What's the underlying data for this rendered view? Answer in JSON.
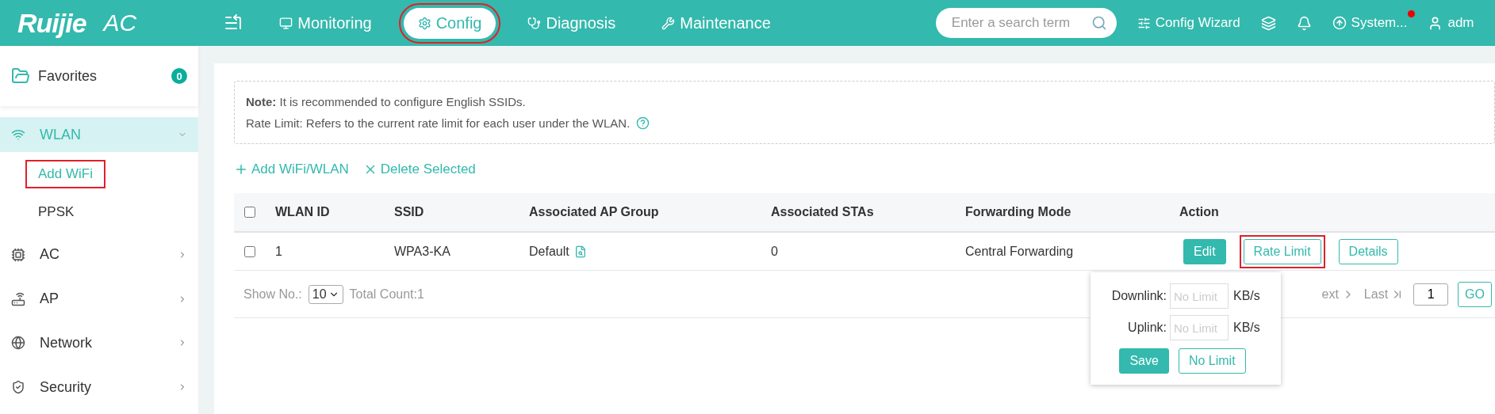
{
  "header": {
    "logo": "Ruijie",
    "product": "AC",
    "nav": [
      {
        "label": "Monitoring",
        "selected": false,
        "highlighted": false
      },
      {
        "label": "Config",
        "selected": true,
        "highlighted": true
      },
      {
        "label": "Diagnosis",
        "selected": false,
        "highlighted": false
      },
      {
        "label": "Maintenance",
        "selected": false,
        "highlighted": false
      }
    ],
    "search": {
      "placeholder": "Enter a search term"
    },
    "config_wizard": "Config Wizard",
    "system": {
      "label": "System...",
      "alert": true
    },
    "user": "adm"
  },
  "sidebar": {
    "favorites": {
      "label": "Favorites",
      "count": "0"
    },
    "items": [
      {
        "label": "WLAN",
        "selected": true,
        "expanded": true,
        "children": [
          {
            "label": "Add WiFi",
            "selected": true,
            "highlighted": true
          },
          {
            "label": "PPSK",
            "selected": false,
            "highlighted": false
          }
        ]
      },
      {
        "label": "AC",
        "selected": false,
        "expanded": false
      },
      {
        "label": "AP",
        "selected": false,
        "expanded": false
      },
      {
        "label": "Network",
        "selected": false,
        "expanded": false
      },
      {
        "label": "Security",
        "selected": false,
        "expanded": false
      }
    ]
  },
  "note": {
    "lines": [
      "**Note:**  It is recommended to configure English SSIDs.",
      "Rate Limit: Refers to the current rate limit for each user under the WLAN."
    ]
  },
  "toolbar": [
    {
      "kind": "add",
      "label": "Add WiFi/WLAN"
    },
    {
      "kind": "delete",
      "label": "Delete Selected"
    }
  ],
  "table": {
    "select_all": {
      "checked": false
    },
    "columns": [
      "WLAN ID",
      "SSID",
      "Associated AP Group",
      "Associated STAs",
      "Forwarding Mode",
      "Action"
    ],
    "rows": [
      {
        "checked": false,
        "cells": [
          "1",
          "WPA3-KA",
          "Default",
          "0",
          "Central Forwarding"
        ],
        "actions": [
          {
            "kind": "primary",
            "label": "Edit",
            "highlighted": false
          },
          {
            "kind": "outline",
            "label": "Rate Limit",
            "highlighted": true
          },
          {
            "kind": "outline",
            "label": "Details",
            "highlighted": false
          }
        ]
      }
    ]
  },
  "pager": {
    "show_label": "Show No.:",
    "page_size": "10",
    "total": "Total Count:1",
    "next": "ext",
    "last": "Last",
    "page": "1",
    "go": "GO"
  },
  "popover": {
    "rows": [
      {
        "label": "Downlink:",
        "placeholder": "No Limit",
        "unit": "KB/s"
      },
      {
        "label": "Uplink:",
        "placeholder": "No Limit",
        "unit": "KB/s"
      }
    ],
    "buttons": [
      {
        "kind": "primary",
        "label": "Save"
      },
      {
        "kind": "outline",
        "label": "No Limit"
      }
    ]
  }
}
